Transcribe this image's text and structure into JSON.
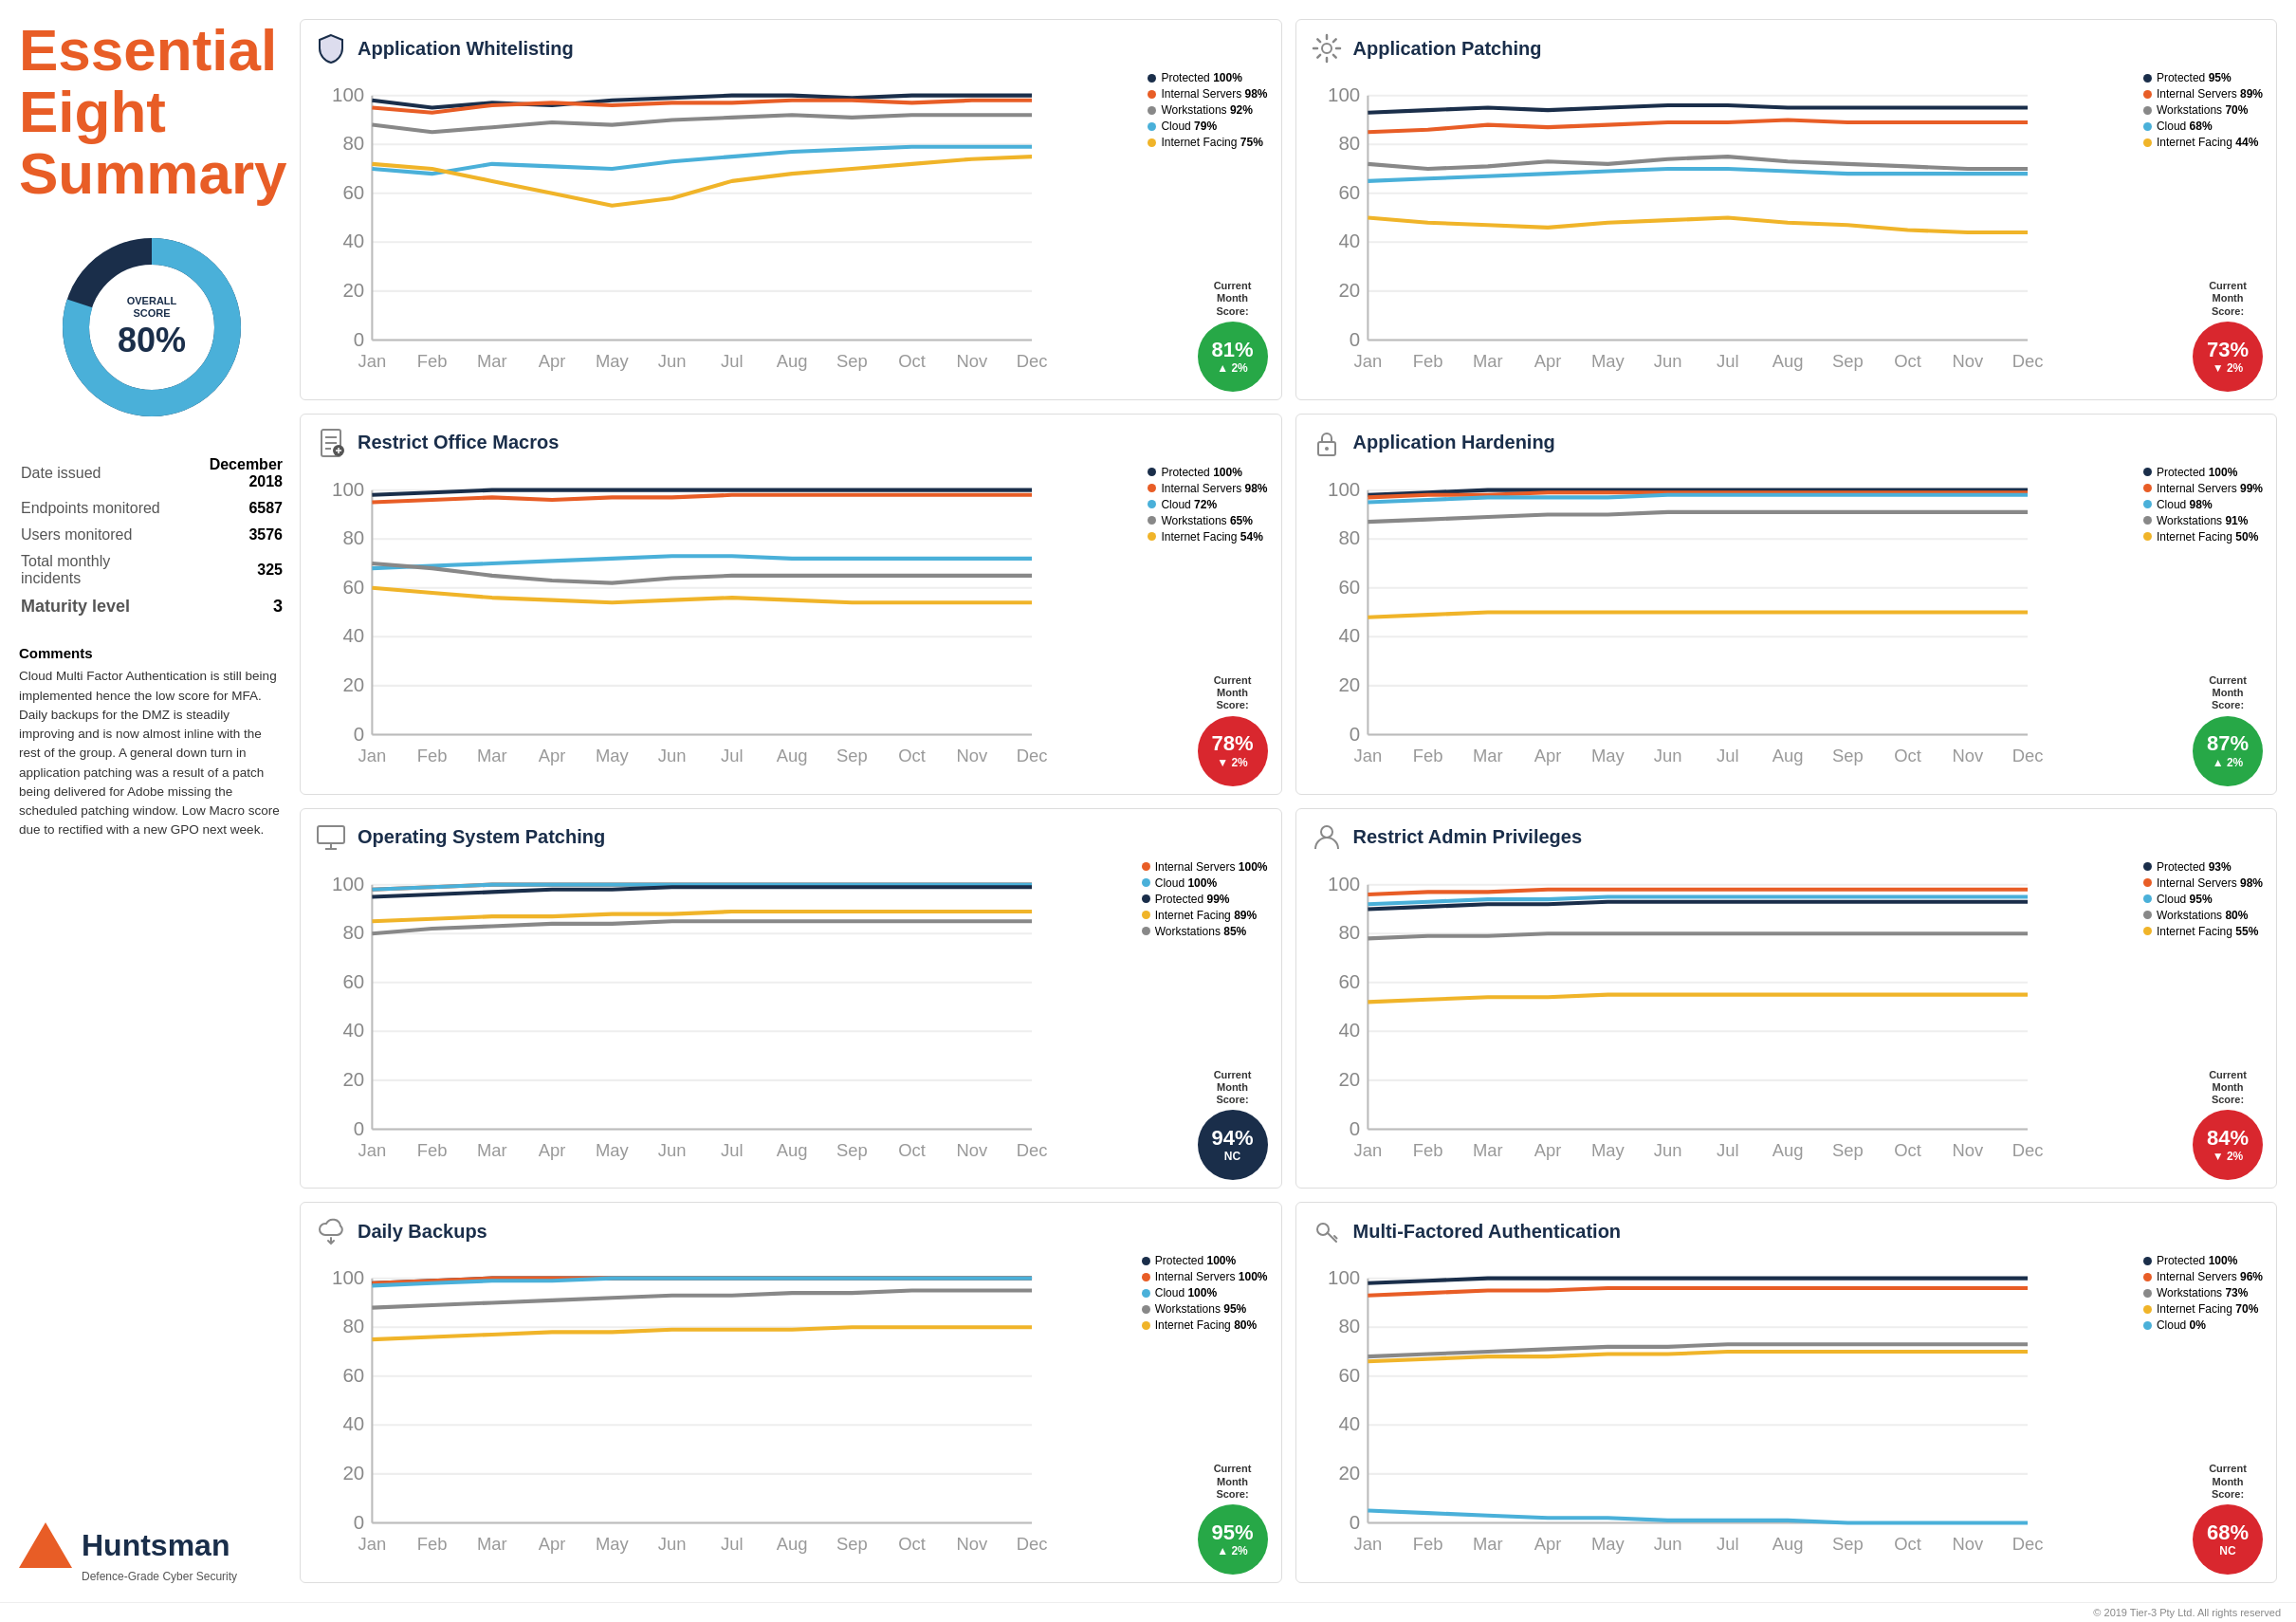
{
  "title": {
    "line1": "Essential",
    "line2": "Eight",
    "line3": "Summary"
  },
  "overall_score": {
    "label": "OVERALL\nSCORE",
    "value": "80%",
    "percentage": 80
  },
  "meta": {
    "date_issued_label": "Date issued",
    "date_issued_value": "December 2018",
    "endpoints_label": "Endpoints monitored",
    "endpoints_value": "6587",
    "users_label": "Users monitored",
    "users_value": "3576",
    "incidents_label": "Total monthly incidents",
    "incidents_value": "325",
    "maturity_label": "Maturity level",
    "maturity_value": "3"
  },
  "comments": {
    "heading": "Comments",
    "text": "Cloud Multi Factor Authentication is still being implemented hence the low score for MFA. Daily backups for the DMZ is steadily improving and is now almost inline with the rest of the group. A general down turn in application patching was a result of a patch being delivered for Adobe missing the scheduled patching window. Low Macro score due to rectified with a new GPO next week."
  },
  "logo": {
    "name": "Huntsman",
    "tagline": "Defence-Grade Cyber Security"
  },
  "charts": [
    {
      "id": "app-whitelisting",
      "title": "Application Whitelisting",
      "icon": "shield",
      "score": "81%",
      "trend": "▲ 2%",
      "badge_color": "green",
      "legend": [
        {
          "label": "Protected",
          "value": "100%",
          "color": "#1a2e4a"
        },
        {
          "label": "Internal Servers",
          "value": "98%",
          "color": "#e85d26"
        },
        {
          "label": "Workstations",
          "value": "92%",
          "color": "#888"
        },
        {
          "label": "Cloud",
          "value": "79%",
          "color": "#4ab0d9"
        },
        {
          "label": "Internet Facing",
          "value": "75%",
          "color": "#f0b429"
        }
      ],
      "months": [
        "Jan",
        "Feb",
        "Mar",
        "Apr",
        "May",
        "Jun",
        "Jul",
        "Aug",
        "Sep",
        "Oct",
        "Nov",
        "Dec"
      ],
      "series": [
        [
          98,
          95,
          97,
          96,
          98,
          99,
          100,
          100,
          99,
          100,
          100,
          100
        ],
        [
          95,
          93,
          96,
          97,
          96,
          97,
          97,
          98,
          98,
          97,
          98,
          98
        ],
        [
          88,
          85,
          87,
          89,
          88,
          90,
          91,
          92,
          91,
          92,
          92,
          92
        ],
        [
          70,
          68,
          72,
          71,
          70,
          73,
          75,
          77,
          78,
          79,
          79,
          79
        ],
        [
          72,
          70,
          65,
          60,
          55,
          58,
          65,
          68,
          70,
          72,
          74,
          75
        ]
      ],
      "series_colors": [
        "#1a2e4a",
        "#e85d26",
        "#888",
        "#4ab0d9",
        "#f0b429"
      ]
    },
    {
      "id": "app-patching",
      "title": "Application Patching",
      "icon": "gear",
      "score": "73%",
      "trend": "▼ 2%",
      "badge_color": "red",
      "legend": [
        {
          "label": "Protected",
          "value": "95%",
          "color": "#1a2e4a"
        },
        {
          "label": "Internal Servers",
          "value": "89%",
          "color": "#e85d26"
        },
        {
          "label": "Workstations",
          "value": "70%",
          "color": "#888"
        },
        {
          "label": "Cloud",
          "value": "68%",
          "color": "#4ab0d9"
        },
        {
          "label": "Internet Facing",
          "value": "44%",
          "color": "#f0b429"
        }
      ],
      "months": [
        "Jan",
        "Feb",
        "Mar",
        "Apr",
        "May",
        "Jun",
        "Jul",
        "Aug",
        "Sep",
        "Oct",
        "Nov",
        "Dec"
      ],
      "series": [
        [
          93,
          94,
          95,
          94,
          95,
          96,
          96,
          95,
          95,
          95,
          95,
          95
        ],
        [
          85,
          86,
          88,
          87,
          88,
          89,
          89,
          90,
          89,
          89,
          89,
          89
        ],
        [
          72,
          70,
          71,
          73,
          72,
          74,
          75,
          73,
          72,
          71,
          70,
          70
        ],
        [
          65,
          66,
          67,
          68,
          69,
          70,
          70,
          69,
          68,
          68,
          68,
          68
        ],
        [
          50,
          48,
          47,
          46,
          48,
          49,
          50,
          48,
          47,
          45,
          44,
          44
        ]
      ],
      "series_colors": [
        "#1a2e4a",
        "#e85d26",
        "#888",
        "#4ab0d9",
        "#f0b429"
      ]
    },
    {
      "id": "restrict-macros",
      "title": "Restrict Office Macros",
      "icon": "document",
      "score": "78%",
      "trend": "▼ 2%",
      "badge_color": "red",
      "legend": [
        {
          "label": "Protected",
          "value": "100%",
          "color": "#1a2e4a"
        },
        {
          "label": "Internal Servers",
          "value": "98%",
          "color": "#e85d26"
        },
        {
          "label": "Cloud",
          "value": "72%",
          "color": "#4ab0d9"
        },
        {
          "label": "Workstations",
          "value": "65%",
          "color": "#888"
        },
        {
          "label": "Internet Facing",
          "value": "54%",
          "color": "#f0b429"
        }
      ],
      "months": [
        "Jan",
        "Feb",
        "Mar",
        "Apr",
        "May",
        "Jun",
        "Jul",
        "Aug",
        "Sep",
        "Oct",
        "Nov",
        "Dec"
      ],
      "series": [
        [
          98,
          99,
          100,
          100,
          100,
          100,
          100,
          100,
          100,
          100,
          100,
          100
        ],
        [
          95,
          96,
          97,
          96,
          97,
          97,
          98,
          98,
          98,
          98,
          98,
          98
        ],
        [
          68,
          69,
          70,
          71,
          72,
          73,
          73,
          72,
          72,
          72,
          72,
          72
        ],
        [
          70,
          68,
          65,
          63,
          62,
          64,
          65,
          65,
          65,
          65,
          65,
          65
        ],
        [
          60,
          58,
          56,
          55,
          54,
          55,
          56,
          55,
          54,
          54,
          54,
          54
        ]
      ],
      "series_colors": [
        "#1a2e4a",
        "#e85d26",
        "#4ab0d9",
        "#888",
        "#f0b429"
      ]
    },
    {
      "id": "app-hardening",
      "title": "Application Hardening",
      "icon": "lock",
      "score": "87%",
      "trend": "▲ 2%",
      "badge_color": "green",
      "legend": [
        {
          "label": "Protected",
          "value": "100%",
          "color": "#1a2e4a"
        },
        {
          "label": "Internal Servers",
          "value": "99%",
          "color": "#e85d26"
        },
        {
          "label": "Cloud",
          "value": "98%",
          "color": "#4ab0d9"
        },
        {
          "label": "Workstations",
          "value": "91%",
          "color": "#888"
        },
        {
          "label": "Internet Facing",
          "value": "50%",
          "color": "#f0b429"
        }
      ],
      "months": [
        "Jan",
        "Feb",
        "Mar",
        "Apr",
        "May",
        "Jun",
        "Jul",
        "Aug",
        "Sep",
        "Oct",
        "Nov",
        "Dec"
      ],
      "series": [
        [
          98,
          99,
          100,
          100,
          100,
          100,
          100,
          100,
          100,
          100,
          100,
          100
        ],
        [
          97,
          98,
          98,
          99,
          99,
          99,
          99,
          99,
          99,
          99,
          99,
          99
        ],
        [
          95,
          96,
          97,
          97,
          97,
          98,
          98,
          98,
          98,
          98,
          98,
          98
        ],
        [
          87,
          88,
          89,
          90,
          90,
          91,
          91,
          91,
          91,
          91,
          91,
          91
        ],
        [
          48,
          49,
          50,
          50,
          50,
          50,
          50,
          50,
          50,
          50,
          50,
          50
        ]
      ],
      "series_colors": [
        "#1a2e4a",
        "#e85d26",
        "#4ab0d9",
        "#888",
        "#f0b429"
      ]
    },
    {
      "id": "os-patching",
      "title": "Operating System Patching",
      "icon": "monitor",
      "score": "94%",
      "trend": "NC",
      "badge_color": "dark",
      "legend": [
        {
          "label": "Internal Servers",
          "value": "100%",
          "color": "#e85d26"
        },
        {
          "label": "Cloud",
          "value": "100%",
          "color": "#4ab0d9"
        },
        {
          "label": "Protected",
          "value": "99%",
          "color": "#1a2e4a"
        },
        {
          "label": "Internet Facing",
          "value": "89%",
          "color": "#f0b429"
        },
        {
          "label": "Workstations",
          "value": "85%",
          "color": "#888"
        }
      ],
      "months": [
        "Jan",
        "Feb",
        "Mar",
        "Apr",
        "May",
        "Jun",
        "Jul",
        "Aug",
        "Sep",
        "Oct",
        "Nov",
        "Dec"
      ],
      "series": [
        [
          98,
          99,
          100,
          100,
          100,
          100,
          100,
          100,
          100,
          100,
          100,
          100
        ],
        [
          98,
          99,
          100,
          100,
          100,
          100,
          100,
          100,
          100,
          100,
          100,
          100
        ],
        [
          95,
          96,
          97,
          98,
          98,
          99,
          99,
          99,
          99,
          99,
          99,
          99
        ],
        [
          85,
          86,
          87,
          87,
          88,
          88,
          89,
          89,
          89,
          89,
          89,
          89
        ],
        [
          80,
          82,
          83,
          84,
          84,
          85,
          85,
          85,
          85,
          85,
          85,
          85
        ]
      ],
      "series_colors": [
        "#e85d26",
        "#4ab0d9",
        "#1a2e4a",
        "#f0b429",
        "#888"
      ]
    },
    {
      "id": "restrict-admin",
      "title": "Restrict Admin Privileges",
      "icon": "user",
      "score": "84%",
      "trend": "▼ 2%",
      "badge_color": "red",
      "legend": [
        {
          "label": "Protected",
          "value": "93%",
          "color": "#1a2e4a"
        },
        {
          "label": "Internal Servers",
          "value": "98%",
          "color": "#e85d26"
        },
        {
          "label": "Cloud",
          "value": "95%",
          "color": "#4ab0d9"
        },
        {
          "label": "Workstations",
          "value": "80%",
          "color": "#888"
        },
        {
          "label": "Internet Facing",
          "value": "55%",
          "color": "#f0b429"
        }
      ],
      "months": [
        "Jan",
        "Feb",
        "Mar",
        "Apr",
        "May",
        "Jun",
        "Jul",
        "Aug",
        "Sep",
        "Oct",
        "Nov",
        "Dec"
      ],
      "series": [
        [
          90,
          91,
          92,
          92,
          93,
          93,
          93,
          93,
          93,
          93,
          93,
          93
        ],
        [
          96,
          97,
          97,
          98,
          98,
          98,
          98,
          98,
          98,
          98,
          98,
          98
        ],
        [
          92,
          93,
          94,
          94,
          95,
          95,
          95,
          95,
          95,
          95,
          95,
          95
        ],
        [
          78,
          79,
          79,
          80,
          80,
          80,
          80,
          80,
          80,
          80,
          80,
          80
        ],
        [
          52,
          53,
          54,
          54,
          55,
          55,
          55,
          55,
          55,
          55,
          55,
          55
        ]
      ],
      "series_colors": [
        "#1a2e4a",
        "#e85d26",
        "#4ab0d9",
        "#888",
        "#f0b429"
      ]
    },
    {
      "id": "daily-backups",
      "title": "Daily Backups",
      "icon": "backup",
      "score": "95%",
      "trend": "▲ 2%",
      "badge_color": "green",
      "legend": [
        {
          "label": "Protected",
          "value": "100%",
          "color": "#1a2e4a"
        },
        {
          "label": "Internal Servers",
          "value": "100%",
          "color": "#e85d26"
        },
        {
          "label": "Cloud",
          "value": "100%",
          "color": "#4ab0d9"
        },
        {
          "label": "Workstations",
          "value": "95%",
          "color": "#888"
        },
        {
          "label": "Internet Facing",
          "value": "80%",
          "color": "#f0b429"
        }
      ],
      "months": [
        "Jan",
        "Feb",
        "Mar",
        "Apr",
        "May",
        "Jun",
        "Jul",
        "Aug",
        "Sep",
        "Oct",
        "Nov",
        "Dec"
      ],
      "series": [
        [
          98,
          99,
          100,
          100,
          100,
          100,
          100,
          100,
          100,
          100,
          100,
          100
        ],
        [
          98,
          99,
          100,
          100,
          100,
          100,
          100,
          100,
          100,
          100,
          100,
          100
        ],
        [
          97,
          98,
          99,
          99,
          100,
          100,
          100,
          100,
          100,
          100,
          100,
          100
        ],
        [
          88,
          89,
          90,
          91,
          92,
          93,
          93,
          94,
          94,
          95,
          95,
          95
        ],
        [
          75,
          76,
          77,
          78,
          78,
          79,
          79,
          79,
          80,
          80,
          80,
          80
        ]
      ],
      "series_colors": [
        "#1a2e4a",
        "#e85d26",
        "#4ab0d9",
        "#888",
        "#f0b429"
      ]
    },
    {
      "id": "mfa",
      "title": "Multi-Factored Authentication",
      "icon": "key",
      "score": "68%",
      "trend": "NC",
      "badge_color": "red",
      "legend": [
        {
          "label": "Protected",
          "value": "100%",
          "color": "#1a2e4a"
        },
        {
          "label": "Internal Servers",
          "value": "96%",
          "color": "#e85d26"
        },
        {
          "label": "Workstations",
          "value": "73%",
          "color": "#888"
        },
        {
          "label": "Internet Facing",
          "value": "70%",
          "color": "#f0b429"
        },
        {
          "label": "Cloud",
          "value": "0%",
          "color": "#4ab0d9"
        }
      ],
      "months": [
        "Jan",
        "Feb",
        "Mar",
        "Apr",
        "May",
        "Jun",
        "Jul",
        "Aug",
        "Sep",
        "Oct",
        "Nov",
        "Dec"
      ],
      "series": [
        [
          98,
          99,
          100,
          100,
          100,
          100,
          100,
          100,
          100,
          100,
          100,
          100
        ],
        [
          93,
          94,
          95,
          95,
          96,
          96,
          96,
          96,
          96,
          96,
          96,
          96
        ],
        [
          68,
          69,
          70,
          71,
          72,
          72,
          73,
          73,
          73,
          73,
          73,
          73
        ],
        [
          66,
          67,
          68,
          68,
          69,
          69,
          70,
          70,
          70,
          70,
          70,
          70
        ],
        [
          5,
          4,
          3,
          2,
          2,
          1,
          1,
          1,
          0,
          0,
          0,
          0
        ]
      ],
      "series_colors": [
        "#1a2e4a",
        "#e85d26",
        "#888",
        "#f0b429",
        "#4ab0d9"
      ]
    }
  ],
  "footer": "© 2019 Tier-3 Pty Ltd. All rights reserved"
}
